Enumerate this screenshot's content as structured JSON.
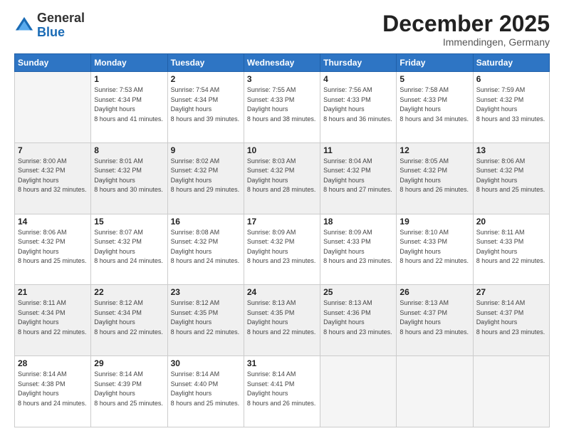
{
  "header": {
    "logo_general": "General",
    "logo_blue": "Blue",
    "month_title": "December 2025",
    "subtitle": "Immendingen, Germany"
  },
  "days_of_week": [
    "Sunday",
    "Monday",
    "Tuesday",
    "Wednesday",
    "Thursday",
    "Friday",
    "Saturday"
  ],
  "weeks": [
    [
      {
        "day": "",
        "sunrise": "",
        "sunset": "",
        "daylight": ""
      },
      {
        "day": "1",
        "sunrise": "Sunrise: 7:53 AM",
        "sunset": "Sunset: 4:34 PM",
        "daylight": "Daylight: 8 hours and 41 minutes."
      },
      {
        "day": "2",
        "sunrise": "Sunrise: 7:54 AM",
        "sunset": "Sunset: 4:34 PM",
        "daylight": "Daylight: 8 hours and 39 minutes."
      },
      {
        "day": "3",
        "sunrise": "Sunrise: 7:55 AM",
        "sunset": "Sunset: 4:33 PM",
        "daylight": "Daylight: 8 hours and 38 minutes."
      },
      {
        "day": "4",
        "sunrise": "Sunrise: 7:56 AM",
        "sunset": "Sunset: 4:33 PM",
        "daylight": "Daylight: 8 hours and 36 minutes."
      },
      {
        "day": "5",
        "sunrise": "Sunrise: 7:58 AM",
        "sunset": "Sunset: 4:33 PM",
        "daylight": "Daylight: 8 hours and 34 minutes."
      },
      {
        "day": "6",
        "sunrise": "Sunrise: 7:59 AM",
        "sunset": "Sunset: 4:32 PM",
        "daylight": "Daylight: 8 hours and 33 minutes."
      }
    ],
    [
      {
        "day": "7",
        "sunrise": "Sunrise: 8:00 AM",
        "sunset": "Sunset: 4:32 PM",
        "daylight": "Daylight: 8 hours and 32 minutes."
      },
      {
        "day": "8",
        "sunrise": "Sunrise: 8:01 AM",
        "sunset": "Sunset: 4:32 PM",
        "daylight": "Daylight: 8 hours and 30 minutes."
      },
      {
        "day": "9",
        "sunrise": "Sunrise: 8:02 AM",
        "sunset": "Sunset: 4:32 PM",
        "daylight": "Daylight: 8 hours and 29 minutes."
      },
      {
        "day": "10",
        "sunrise": "Sunrise: 8:03 AM",
        "sunset": "Sunset: 4:32 PM",
        "daylight": "Daylight: 8 hours and 28 minutes."
      },
      {
        "day": "11",
        "sunrise": "Sunrise: 8:04 AM",
        "sunset": "Sunset: 4:32 PM",
        "daylight": "Daylight: 8 hours and 27 minutes."
      },
      {
        "day": "12",
        "sunrise": "Sunrise: 8:05 AM",
        "sunset": "Sunset: 4:32 PM",
        "daylight": "Daylight: 8 hours and 26 minutes."
      },
      {
        "day": "13",
        "sunrise": "Sunrise: 8:06 AM",
        "sunset": "Sunset: 4:32 PM",
        "daylight": "Daylight: 8 hours and 25 minutes."
      }
    ],
    [
      {
        "day": "14",
        "sunrise": "Sunrise: 8:06 AM",
        "sunset": "Sunset: 4:32 PM",
        "daylight": "Daylight: 8 hours and 25 minutes."
      },
      {
        "day": "15",
        "sunrise": "Sunrise: 8:07 AM",
        "sunset": "Sunset: 4:32 PM",
        "daylight": "Daylight: 8 hours and 24 minutes."
      },
      {
        "day": "16",
        "sunrise": "Sunrise: 8:08 AM",
        "sunset": "Sunset: 4:32 PM",
        "daylight": "Daylight: 8 hours and 24 minutes."
      },
      {
        "day": "17",
        "sunrise": "Sunrise: 8:09 AM",
        "sunset": "Sunset: 4:32 PM",
        "daylight": "Daylight: 8 hours and 23 minutes."
      },
      {
        "day": "18",
        "sunrise": "Sunrise: 8:09 AM",
        "sunset": "Sunset: 4:33 PM",
        "daylight": "Daylight: 8 hours and 23 minutes."
      },
      {
        "day": "19",
        "sunrise": "Sunrise: 8:10 AM",
        "sunset": "Sunset: 4:33 PM",
        "daylight": "Daylight: 8 hours and 22 minutes."
      },
      {
        "day": "20",
        "sunrise": "Sunrise: 8:11 AM",
        "sunset": "Sunset: 4:33 PM",
        "daylight": "Daylight: 8 hours and 22 minutes."
      }
    ],
    [
      {
        "day": "21",
        "sunrise": "Sunrise: 8:11 AM",
        "sunset": "Sunset: 4:34 PM",
        "daylight": "Daylight: 8 hours and 22 minutes."
      },
      {
        "day": "22",
        "sunrise": "Sunrise: 8:12 AM",
        "sunset": "Sunset: 4:34 PM",
        "daylight": "Daylight: 8 hours and 22 minutes."
      },
      {
        "day": "23",
        "sunrise": "Sunrise: 8:12 AM",
        "sunset": "Sunset: 4:35 PM",
        "daylight": "Daylight: 8 hours and 22 minutes."
      },
      {
        "day": "24",
        "sunrise": "Sunrise: 8:13 AM",
        "sunset": "Sunset: 4:35 PM",
        "daylight": "Daylight: 8 hours and 22 minutes."
      },
      {
        "day": "25",
        "sunrise": "Sunrise: 8:13 AM",
        "sunset": "Sunset: 4:36 PM",
        "daylight": "Daylight: 8 hours and 23 minutes."
      },
      {
        "day": "26",
        "sunrise": "Sunrise: 8:13 AM",
        "sunset": "Sunset: 4:37 PM",
        "daylight": "Daylight: 8 hours and 23 minutes."
      },
      {
        "day": "27",
        "sunrise": "Sunrise: 8:14 AM",
        "sunset": "Sunset: 4:37 PM",
        "daylight": "Daylight: 8 hours and 23 minutes."
      }
    ],
    [
      {
        "day": "28",
        "sunrise": "Sunrise: 8:14 AM",
        "sunset": "Sunset: 4:38 PM",
        "daylight": "Daylight: 8 hours and 24 minutes."
      },
      {
        "day": "29",
        "sunrise": "Sunrise: 8:14 AM",
        "sunset": "Sunset: 4:39 PM",
        "daylight": "Daylight: 8 hours and 25 minutes."
      },
      {
        "day": "30",
        "sunrise": "Sunrise: 8:14 AM",
        "sunset": "Sunset: 4:40 PM",
        "daylight": "Daylight: 8 hours and 25 minutes."
      },
      {
        "day": "31",
        "sunrise": "Sunrise: 8:14 AM",
        "sunset": "Sunset: 4:41 PM",
        "daylight": "Daylight: 8 hours and 26 minutes."
      },
      {
        "day": "",
        "sunrise": "",
        "sunset": "",
        "daylight": ""
      },
      {
        "day": "",
        "sunrise": "",
        "sunset": "",
        "daylight": ""
      },
      {
        "day": "",
        "sunrise": "",
        "sunset": "",
        "daylight": ""
      }
    ]
  ],
  "colors": {
    "header_bg": "#2e75c4",
    "alt_row_bg": "#f0f0f0",
    "empty_bg": "#f5f5f5"
  }
}
